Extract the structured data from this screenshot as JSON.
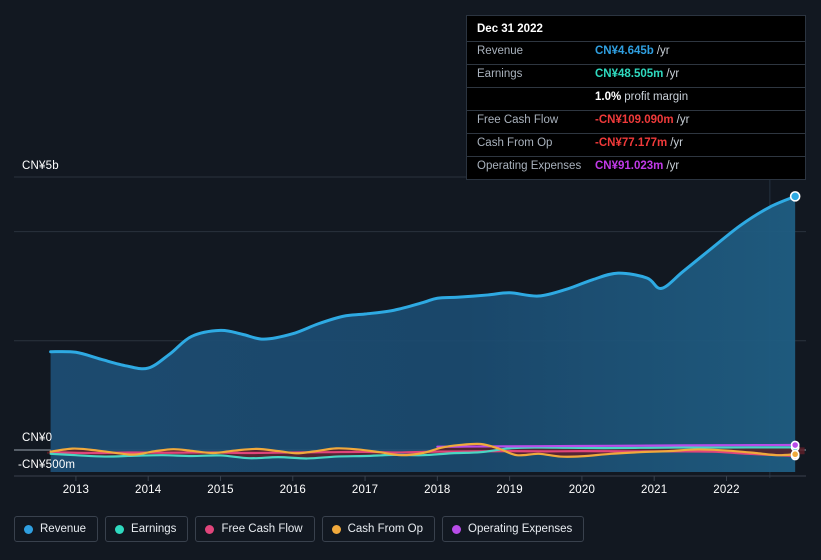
{
  "chart_data": {
    "type": "area",
    "title": "",
    "xlabel": "",
    "ylabel": "",
    "grid": true,
    "legend_position": "bottom-left",
    "ylim": [
      -500,
      5000
    ],
    "y_unit": "CN¥ millions",
    "y_ticks": [
      {
        "value": 5000,
        "label": "CN¥5b"
      },
      {
        "value": 0,
        "label": "CN¥0"
      },
      {
        "value": -500,
        "label": "-CN¥500m"
      }
    ],
    "x_ticks": [
      "2013",
      "2014",
      "2015",
      "2016",
      "2017",
      "2018",
      "2019",
      "2020",
      "2021",
      "2022"
    ],
    "x_range": [
      "2012.6",
      "2023.1"
    ],
    "series": [
      {
        "name": "Revenue",
        "color": "#2eaae3",
        "x": [
          2012.65,
          2013.0,
          2013.35,
          2013.7,
          2014.0,
          2014.3,
          2014.6,
          2015.0,
          2015.3,
          2015.6,
          2016.0,
          2016.35,
          2016.7,
          2017.0,
          2017.4,
          2017.8,
          2018.0,
          2018.3,
          2018.7,
          2019.0,
          2019.4,
          2019.8,
          2020.15,
          2020.5,
          2020.9,
          2021.1,
          2021.4,
          2021.8,
          2022.2,
          2022.6,
          2022.95
        ],
        "values": [
          1800,
          1790,
          1660,
          1540,
          1500,
          1760,
          2080,
          2190,
          2120,
          2030,
          2130,
          2310,
          2450,
          2490,
          2560,
          2700,
          2780,
          2800,
          2840,
          2880,
          2820,
          2950,
          3120,
          3240,
          3150,
          2960,
          3270,
          3700,
          4120,
          4450,
          4645
        ]
      },
      {
        "name": "Earnings",
        "color": "#4ad6c3",
        "x": [
          2012.65,
          2013.0,
          2013.4,
          2013.8,
          2014.2,
          2014.6,
          2015.0,
          2015.4,
          2015.8,
          2016.2,
          2016.6,
          2017.0,
          2017.4,
          2017.8,
          2018.2,
          2018.6,
          2019.0,
          2019.4,
          2019.8,
          2020.3,
          2020.8,
          2021.3,
          2021.8,
          2022.3,
          2022.95
        ],
        "values": [
          -70,
          -95,
          -120,
          -105,
          -95,
          -110,
          -100,
          -150,
          -130,
          -155,
          -120,
          -110,
          -90,
          -95,
          -60,
          -40,
          30,
          45,
          40,
          35,
          40,
          45,
          45,
          48,
          48.505
        ]
      },
      {
        "name": "Free Cash Flow",
        "color": "#e0457b",
        "x": [
          2012.65,
          2013.2,
          2013.8,
          2014.3,
          2014.9,
          2015.4,
          2016.0,
          2016.5,
          2017.0,
          2017.5,
          2018.0,
          2018.5,
          2019.0,
          2019.5,
          2020.0,
          2020.6,
          2021.2,
          2021.8,
          2022.3,
          2022.95
        ],
        "values": [
          -40,
          -55,
          -45,
          -50,
          -45,
          -55,
          -45,
          -40,
          -35,
          -45,
          -30,
          -25,
          -20,
          -25,
          -20,
          -25,
          -25,
          -30,
          -70,
          -109.09
        ]
      },
      {
        "name": "Cash From Op",
        "color": "#f0a93c",
        "x": [
          2012.65,
          2012.95,
          2013.2,
          2013.5,
          2013.8,
          2014.1,
          2014.35,
          2014.6,
          2014.9,
          2015.2,
          2015.5,
          2015.8,
          2016.05,
          2016.3,
          2016.6,
          2016.9,
          2017.2,
          2017.5,
          2017.8,
          2018.05,
          2018.3,
          2018.6,
          2018.85,
          2019.1,
          2019.4,
          2019.7,
          2020.0,
          2020.4,
          2020.8,
          2021.2,
          2021.6,
          2022.0,
          2022.4,
          2022.7,
          2022.95
        ],
        "values": [
          -30,
          25,
          5,
          -45,
          -85,
          -20,
          15,
          -15,
          -55,
          -10,
          20,
          -20,
          -60,
          -25,
          30,
          10,
          -40,
          -95,
          -55,
          40,
          90,
          110,
          25,
          -95,
          -70,
          -120,
          -115,
          -70,
          -40,
          -20,
          10,
          -10,
          -55,
          -95,
          -77.177
        ]
      },
      {
        "name": "Operating Expenses",
        "color": "#b84ce8",
        "x": [
          2018.0,
          2018.4,
          2018.9,
          2019.4,
          2019.9,
          2020.4,
          2020.9,
          2021.4,
          2021.9,
          2022.4,
          2022.95
        ],
        "values": [
          60,
          63,
          66,
          70,
          73,
          77,
          80,
          84,
          87,
          90,
          91.023
        ]
      }
    ]
  },
  "tooltip": {
    "date": "Dec 31 2022",
    "rows": [
      {
        "key": "Revenue",
        "value": "CN¥4.645b",
        "unit": "/yr",
        "color": "#2f9fe0",
        "indent": false
      },
      {
        "key": "Earnings",
        "value": "CN¥48.505m",
        "unit": "/yr",
        "color": "#2fd9bf",
        "indent": false
      },
      {
        "key": "",
        "value": "1.0%",
        "unit": "profit margin",
        "color": "#ffffff",
        "indent": true
      },
      {
        "key": "Free Cash Flow",
        "value": "-CN¥109.090m",
        "unit": "/yr",
        "color": "#f03a3a",
        "indent": false
      },
      {
        "key": "Cash From Op",
        "value": "-CN¥77.177m",
        "unit": "/yr",
        "color": "#f03a3a",
        "indent": false
      },
      {
        "key": "Operating Expenses",
        "value": "CN¥91.023m",
        "unit": "/yr",
        "color": "#c13ae8",
        "indent": false
      }
    ]
  },
  "legend": {
    "items": [
      {
        "label": "Revenue",
        "color": "#2f9fe0"
      },
      {
        "label": "Earnings",
        "color": "#2fd9bf"
      },
      {
        "label": "Free Cash Flow",
        "color": "#e0457b"
      },
      {
        "label": "Cash From Op",
        "color": "#f0a93c"
      },
      {
        "label": "Operating Expenses",
        "color": "#b84ce8"
      }
    ]
  },
  "y_axis": {
    "top_label": "CN¥5b",
    "zero_label": "CN¥0",
    "bottom_label": "-CN¥500m"
  },
  "x_axis": {
    "ticks": [
      "2013",
      "2014",
      "2015",
      "2016",
      "2017",
      "2018",
      "2019",
      "2020",
      "2021",
      "2022"
    ]
  }
}
